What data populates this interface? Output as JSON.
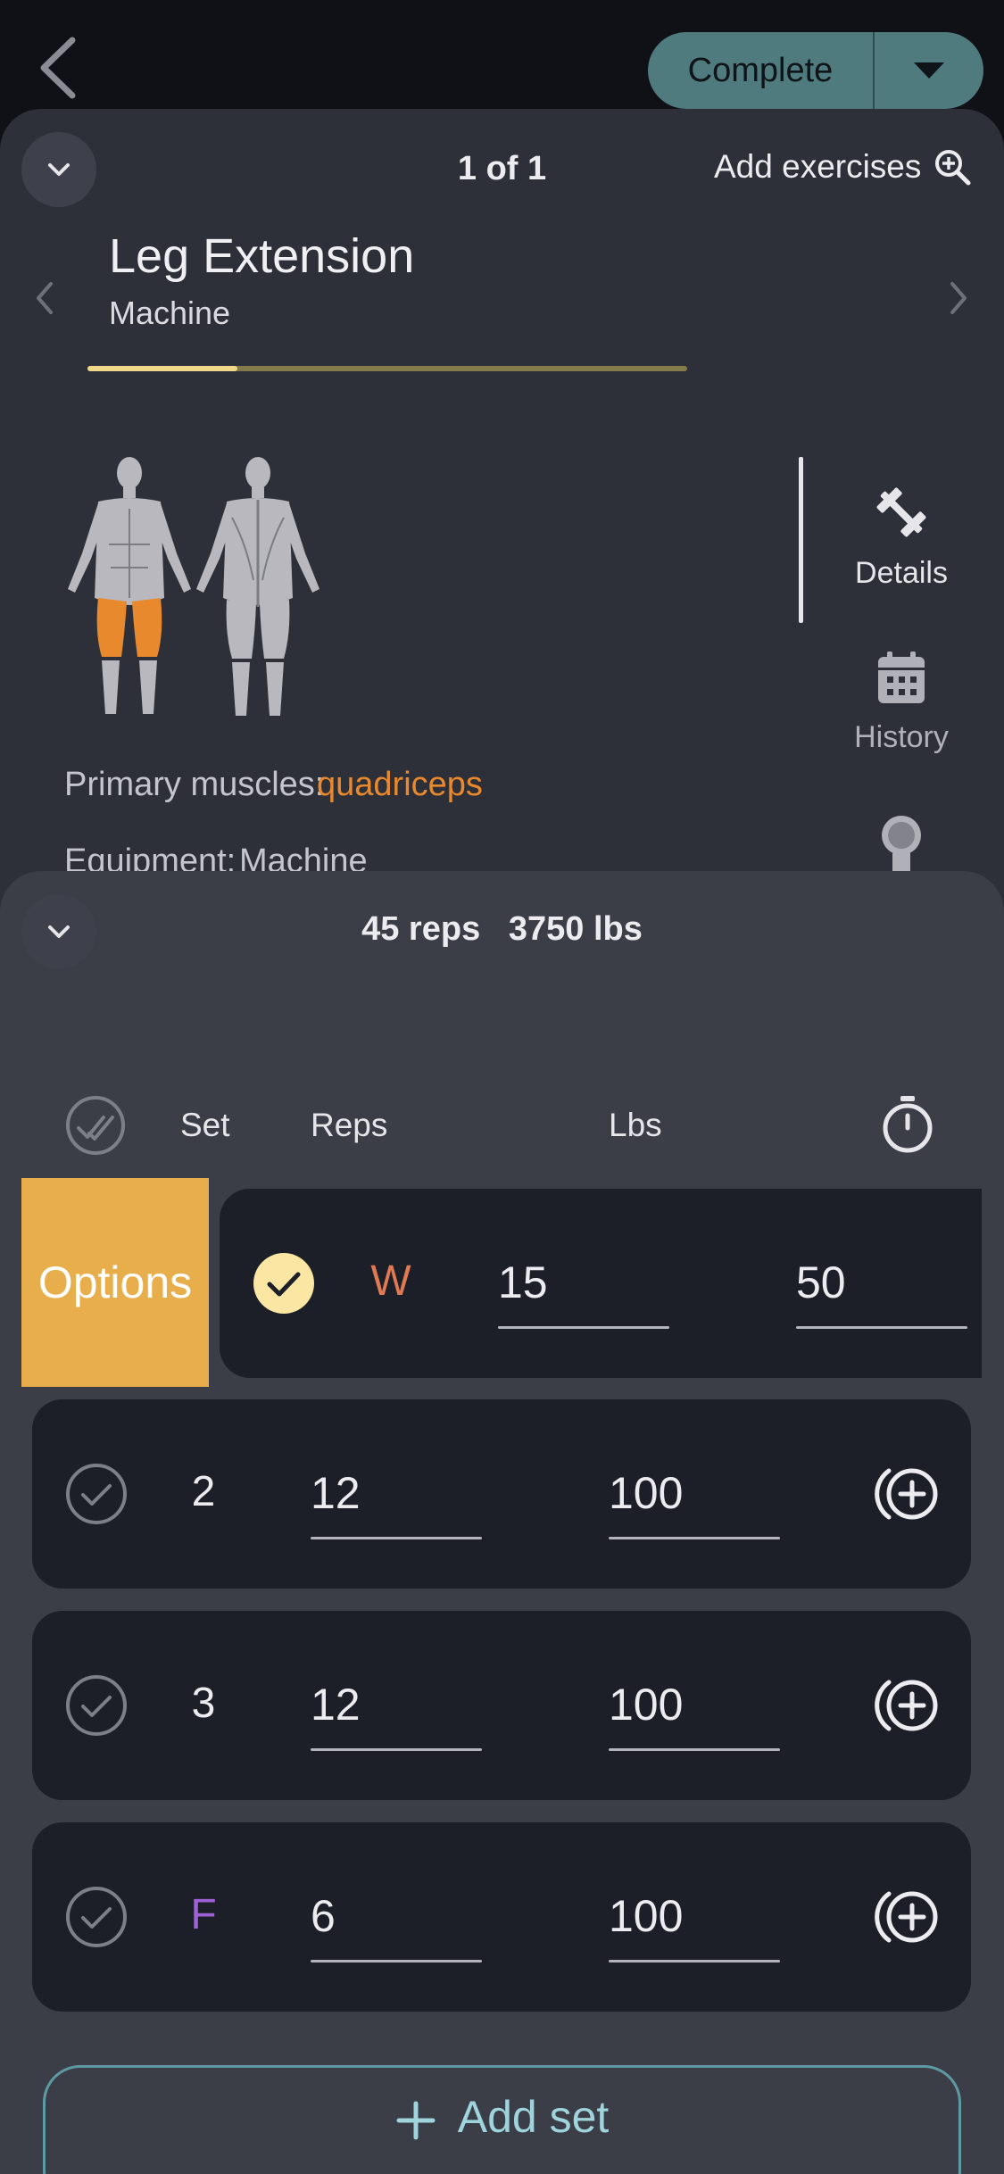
{
  "header": {
    "complete_label": "Complete"
  },
  "exercise": {
    "counter": "1 of 1",
    "add_exercises_label": "Add exercises",
    "title": "Leg Extension",
    "subtitle": "Machine",
    "progress_fraction": 0.25,
    "primary_muscles_label": "Primary muscles:",
    "primary_muscles_value": "quadriceps",
    "equipment_label": "Equipment:",
    "equipment_value": "Machine",
    "side_tabs": [
      {
        "label": "Details",
        "icon": "barbell-icon"
      },
      {
        "label": "History",
        "icon": "calendar-icon"
      },
      {
        "label": "",
        "icon": "medal-icon"
      }
    ]
  },
  "sets": {
    "summary_reps": "45 reps",
    "summary_weight": "3750 lbs",
    "headers": {
      "set": "Set",
      "reps": "Reps",
      "lbs": "Lbs"
    },
    "options_label": "Options",
    "rows": [
      {
        "set": "W",
        "reps": "15",
        "lbs": "50",
        "completed": true
      },
      {
        "set": "2",
        "reps": "12",
        "lbs": "100",
        "completed": false
      },
      {
        "set": "3",
        "reps": "12",
        "lbs": "100",
        "completed": false
      },
      {
        "set": "F",
        "reps": "6",
        "lbs": "100",
        "completed": false
      }
    ],
    "add_set_label": "Add set"
  },
  "colors": {
    "accent_teal": "#4f7a7e",
    "options_orange": "#e8ae4c",
    "warmup_set": "#e07a52",
    "failure_set": "#a060d8",
    "muscle_highlight": "#e8892e",
    "check_done": "#fbe7a3"
  }
}
